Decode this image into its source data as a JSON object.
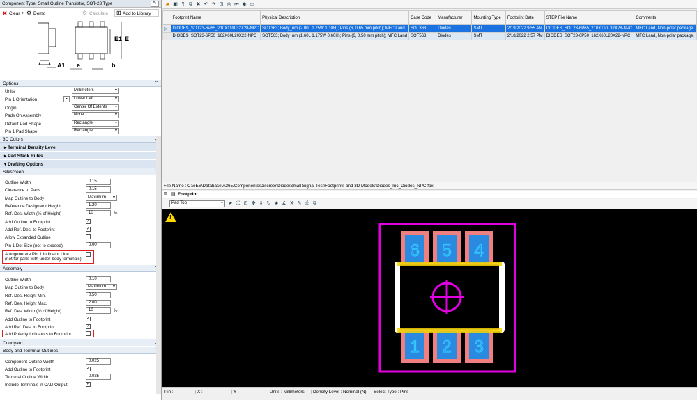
{
  "left": {
    "component_type": "Component Type: Small Outline Transistor, SOT-23 Type",
    "toolbar": {
      "clear": "Clear",
      "demo": "Demo",
      "calculate": "Calculate",
      "add_to_library": "Add to Library"
    },
    "diagram": {
      "labels": [
        "A1",
        "e",
        "b",
        "E1",
        "E"
      ]
    },
    "options": {
      "header": "Options",
      "rows": [
        {
          "label": "Units",
          "value": "Millimeters"
        },
        {
          "label": "Pin 1 Orientation",
          "value": "Lower Left"
        },
        {
          "label": "Origin",
          "value": "Center Of Extents"
        },
        {
          "label": "Pads On Assembly",
          "value": "None"
        },
        {
          "label": "Default Pad Shape",
          "value": "Rectangle"
        },
        {
          "label": "Pin 1 Pad Shape",
          "value": "Rectangle"
        }
      ]
    },
    "colors_3d": "3D Colors",
    "groups": [
      "Terminal Density Level",
      "Pad Stack Rules",
      "Drafting Options"
    ],
    "silkscreen": {
      "header": "Silkscreen",
      "outline_width": {
        "label": "Outline Width",
        "value": "0.15"
      },
      "clearance_to_pads": {
        "label": "Clearance to Pads",
        "value": "0.15"
      },
      "map_outline": {
        "label": "Map Outline to Body",
        "value": "Maximum"
      },
      "ref_height": {
        "label": "Reference Designator Height",
        "value": "1.20"
      },
      "ref_width": {
        "label": "Ref. Des. Width (% of Height)",
        "value": "10",
        "unit": "%"
      },
      "add_outline": "Add Outline to Footprint",
      "add_ref": "Add Ref. Des. to Footprint",
      "allow_expanded": "Allow Expanded Outline",
      "pin1_dot": {
        "label": "Pin 1 Dot Size (not-to-exceed)",
        "value": "0.00"
      },
      "autogen_1": "Autogenerate Pin 1 Indicator Line",
      "autogen_2": "(not for parts with under-body terminals)"
    },
    "assembly": {
      "header": "Assembly",
      "outline_width": {
        "label": "Outline Width",
        "value": "0.10"
      },
      "map_outline": {
        "label": "Map Outline to Body",
        "value": "Maximum"
      },
      "ref_min": {
        "label": "Ref. Des. Height Min.",
        "value": "0.50"
      },
      "ref_max": {
        "label": "Ref. Des. Height Max.",
        "value": "2.00"
      },
      "ref_width": {
        "label": "Ref. Des. Width (% of Height)",
        "value": "10",
        "unit": "%"
      },
      "add_outline": "Add Outline to Footprint",
      "add_ref": "Add Ref. Des. to Footprint",
      "add_polarity": "Add Polarity Indicators to Footprint"
    },
    "courtyard": "Courtyard",
    "body_terminal": {
      "header": "Body and Terminal Outlines",
      "comp_outline": {
        "label": "Component Outline Width",
        "value": "0.025"
      },
      "add_outline": "Add Outline to Footprint",
      "term_outline": {
        "label": "Terminal Outline Width",
        "value": "0.025"
      },
      "include_terms": "Include Terminals in CAD Output"
    }
  },
  "grid": {
    "columns": [
      "Footprint Name",
      "Physical Description",
      "Case Code",
      "Manufacturer",
      "Mounting Type",
      "Footprint Date",
      "STEP File Name",
      "Comments"
    ],
    "rows": [
      [
        "DIODES_SOT23-6P65_210X110L32X28-NPC",
        "SOT363; Body_nm (2.00L 1.25W 1.10H); Pins (6, 0.65 mm pitch); MFC Land",
        "SOT363",
        "Diodes",
        "SMT",
        "2/19/2022 9:55 AM",
        "DIODES_SOT23-6P65_210X110L32X28-NPC",
        "MFC Land, Non-polar package."
      ],
      [
        "DIODES_SOT23-6P50_162X60L20X22-NPC",
        "SOT563; Body_nm (1.60L 1.175W 0.60H); Pins (6, 0.50 mm pitch); MFC Land",
        "SOT563",
        "Diodes",
        "SMT",
        "2/18/2022 2:57 PM",
        "DIODES_SOT23-6P50_162X60L20X22-NPC",
        "MFC Land, Non-polar package."
      ]
    ]
  },
  "file_name": "File Name :  C:\\eES\\Database\\A365\\Components\\Discrete\\Diode\\Small Signal Test\\Footprints and 3D Models\\Diodes_Inc_Diodes_NPC.fpx",
  "footprint": {
    "title": "Footprint",
    "layer": "Pad Top",
    "pins_top": [
      "6",
      "5",
      "4"
    ],
    "pins_bottom": [
      "1",
      "2",
      "3"
    ]
  },
  "status": {
    "pin": "Pin :",
    "x": "X :",
    "y": "Y :",
    "units": "Units :  Millimeters",
    "density": "Density Level :  Nominal (N)",
    "select": "Select Type :  Pins"
  }
}
